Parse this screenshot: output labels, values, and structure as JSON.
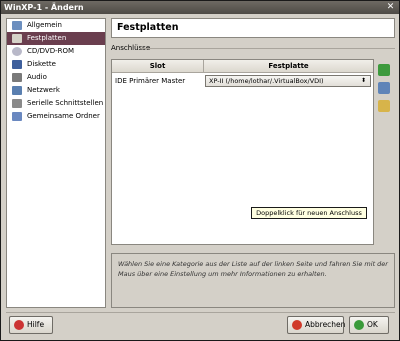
{
  "window": {
    "title": "WinXP-1 - Ändern",
    "close_symbol": "✕"
  },
  "nav": {
    "items": [
      {
        "label": "Allgemein",
        "icon": "general-icon",
        "color": "#6c8fbf"
      },
      {
        "label": "Festplatten",
        "icon": "harddisk-icon",
        "color": "#d6d2c8",
        "selected": true
      },
      {
        "label": "CD/DVD-ROM",
        "icon": "cdrom-icon",
        "color": "#b9b9c9"
      },
      {
        "label": "Diskette",
        "icon": "floppy-icon",
        "color": "#3e5f9c"
      },
      {
        "label": "Audio",
        "icon": "audio-icon",
        "color": "#7a7a7a"
      },
      {
        "label": "Netzwerk",
        "icon": "network-icon",
        "color": "#5a7fb0"
      },
      {
        "label": "Serielle Schnittstellen",
        "icon": "serial-icon",
        "color": "#8a8a8a"
      },
      {
        "label": "Gemeinsame Ordner",
        "icon": "shared-folder-icon",
        "color": "#6a88c0"
      }
    ]
  },
  "content": {
    "title": "Festplatten",
    "group_label": "Anschlüsse",
    "table": {
      "headers": {
        "slot": "Slot",
        "disk": "Festplatte"
      },
      "rows": [
        {
          "slot": "IDE Primärer Master",
          "disk": "XP-II (/home/lothar/.VirtualBox/VDI)",
          "arrow": "⬍"
        }
      ]
    },
    "tooltip": "Doppelklick für neuen Anschluss",
    "side_buttons": [
      {
        "icon": "add-attachment-icon",
        "color": "#3d9a3d"
      },
      {
        "icon": "remove-attachment-icon",
        "color": "#5f84b8"
      },
      {
        "icon": "select-disk-icon",
        "color": "#d7b44a"
      }
    ],
    "info_text": "Wählen Sie eine Kategorie aus der Liste auf der linken Seite und fahren Sie mit der Maus über eine Einstellung um mehr Informationen zu erhalten."
  },
  "buttons": {
    "help": {
      "label": "Hilfe",
      "icon": "help-icon",
      "color": "#c33"
    },
    "cancel": {
      "label": "Abbrechen",
      "icon": "cancel-icon",
      "color": "#d03a2a"
    },
    "ok": {
      "label": "OK",
      "icon": "ok-icon",
      "color": "#3a9a3a"
    }
  }
}
